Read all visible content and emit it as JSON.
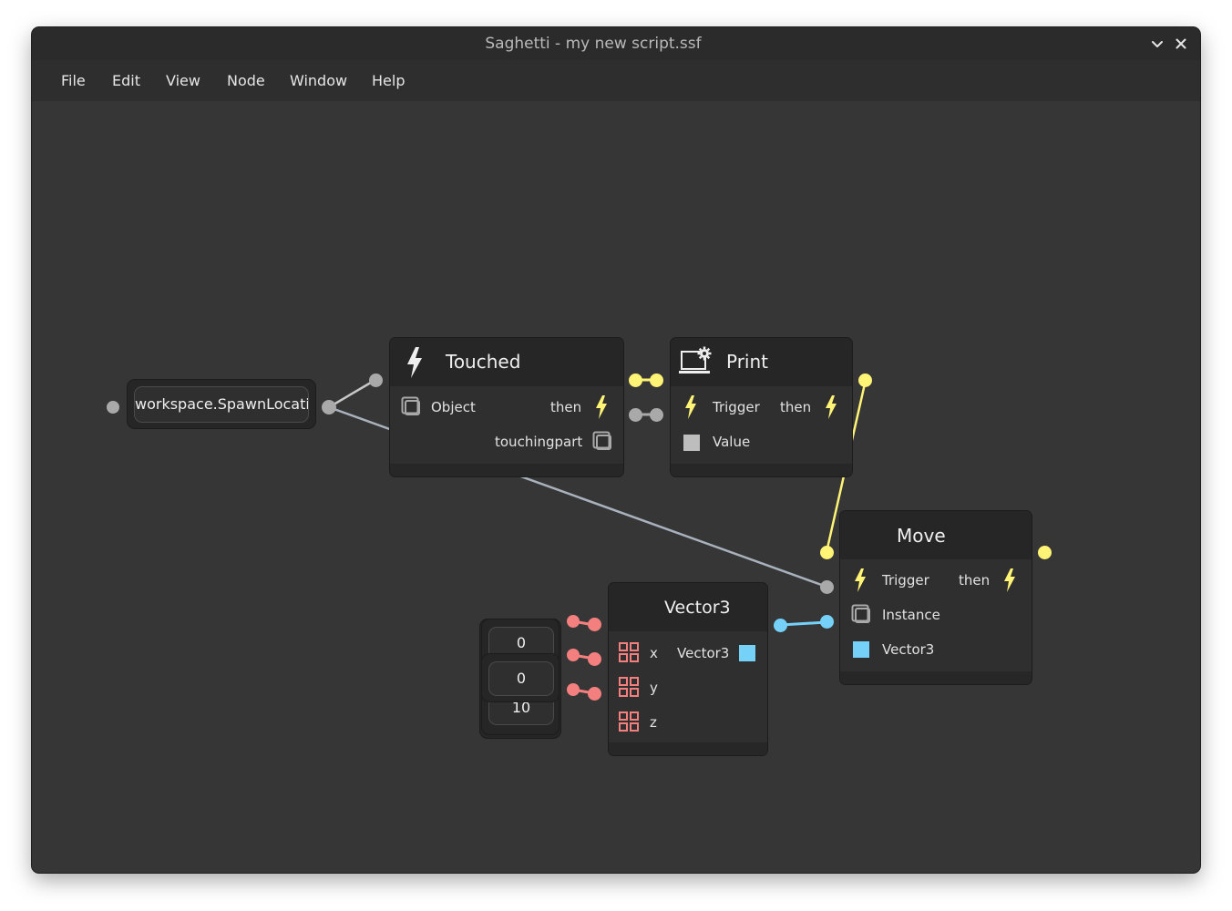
{
  "window": {
    "title": "Saghetti - my new script.ssf"
  },
  "menu": [
    "File",
    "Edit",
    "View",
    "Node",
    "Window",
    "Help"
  ],
  "icons": {
    "minimize": "chevron-down-icon",
    "close": "close-icon",
    "event": "lightning-bolt-icon",
    "object": "object-cube-icon",
    "print": "laptop-gear-icon",
    "number": "number-grid-icon",
    "vector": "vector-square-icon",
    "any": "any-square-icon"
  },
  "colors": {
    "trigger": "#fff475",
    "object": "#a9a9a9",
    "number": "#f47f7f",
    "vector": "#76d1f8",
    "any": "#bdbdbd"
  },
  "nodes": {
    "workspace": {
      "value": "workspace.SpawnLocati"
    },
    "touched": {
      "title": "Touched",
      "object": "Object",
      "then": "then",
      "touchingpart": "touchingpart"
    },
    "print": {
      "title": "Print",
      "trigger": "Trigger",
      "then": "then",
      "value": "Value"
    },
    "move": {
      "title": "Move",
      "trigger": "Trigger",
      "then": "then",
      "instance": "Instance",
      "vector3": "Vector3"
    },
    "vector3": {
      "title": "Vector3",
      "x": "x",
      "y": "y",
      "z": "z",
      "out": "Vector3"
    },
    "numbers": {
      "x": "0",
      "y": "0",
      "z": "10"
    }
  }
}
